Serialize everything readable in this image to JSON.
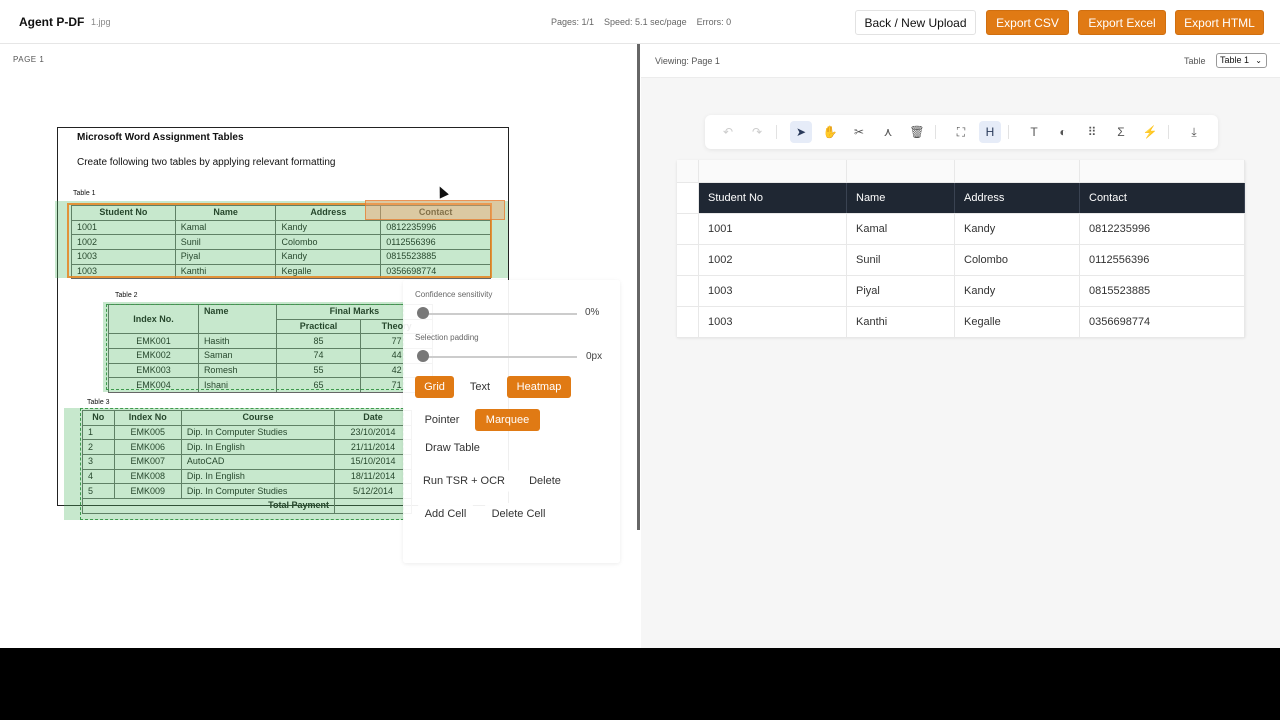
{
  "header": {
    "app_title": "Agent P-DF",
    "file_name": "1.jpg",
    "pages": "Pages: 1/1",
    "speed": "Speed: 5.1 sec/page",
    "errors": "Errors: 0",
    "back_label": "Back / New Upload",
    "export_csv": "Export CSV",
    "export_excel": "Export Excel",
    "export_html": "Export HTML"
  },
  "left": {
    "page_label": "PAGE 1",
    "doc_title": "Microsoft Word Assignment Tables",
    "doc_subtitle": "Create following two tables by applying relevant formatting",
    "table1": {
      "caption": "Table 1",
      "headers": [
        "Student No",
        "Name",
        "Address",
        "Contact"
      ],
      "rows": [
        [
          "1001",
          "Kamal",
          "Kandy",
          "0812235996"
        ],
        [
          "1002",
          "Sunil",
          "Colombo",
          "0112556396"
        ],
        [
          "1003",
          "Piyal",
          "Kandy",
          "0815523885"
        ],
        [
          "1003",
          "Kanthi",
          "Kegalle",
          "0356698774"
        ]
      ]
    },
    "table2": {
      "caption": "Table 2",
      "h_index": "Index No.",
      "h_name": "Name",
      "h_final": "Final Marks",
      "h_practical": "Practical",
      "h_theory": "Theory",
      "rows": [
        [
          "EMK001",
          "Hasith",
          "85",
          "77"
        ],
        [
          "EMK002",
          "Saman",
          "74",
          "44"
        ],
        [
          "EMK003",
          "Romesh",
          "55",
          "42"
        ],
        [
          "EMK004",
          "Ishani",
          "65",
          "71"
        ]
      ]
    },
    "table3": {
      "caption": "Table 3",
      "h_no": "No",
      "h_index": "Index No",
      "h_course": "Course",
      "h_date": "Date",
      "rows": [
        [
          "1",
          "EMK005",
          "Dip. In Computer Studies",
          "23/10/2014"
        ],
        [
          "2",
          "EMK006",
          "Dip. In English",
          "21/11/2014"
        ],
        [
          "3",
          "EMK007",
          "AutoCAD",
          "15/10/2014"
        ],
        [
          "4",
          "EMK008",
          "Dip. In English",
          "18/11/2014"
        ],
        [
          "5",
          "EMK009",
          "Dip. In Computer Studies",
          "5/12/2014"
        ]
      ],
      "total_label": "Total Payment"
    }
  },
  "panel": {
    "confidence_label": "Confidence sensitivity",
    "confidence_value": "0%",
    "confidence_level": 0,
    "padding_label": "Selection padding",
    "padding_value": "0px",
    "padding_level": 0,
    "grid": "Grid",
    "text": "Text",
    "heatmap": "Heatmap",
    "pointer": "Pointer",
    "marquee": "Marquee",
    "draw_table": "Draw Table",
    "run_tsr": "Run TSR + OCR",
    "delete": "Delete",
    "add_cell": "Add Cell",
    "delete_cell": "Delete Cell",
    "active_buttons": [
      "grid",
      "heatmap",
      "marquee"
    ]
  },
  "right": {
    "viewing": "Viewing: Page 1",
    "table_label": "Table",
    "table_select": "Table 1",
    "toolbar_icons": [
      "undo-icon",
      "redo-icon",
      "select-icon",
      "hand-icon",
      "scissors-icon",
      "merge-icon",
      "trash-icon",
      "fit-icon",
      "header-icon",
      "text-icon",
      "palette-icon",
      "grid-dots-icon",
      "sum-icon",
      "magic-icon",
      "download-icon"
    ],
    "grid": {
      "headers": [
        "Student No",
        "Name",
        "Address",
        "Contact"
      ],
      "rows": [
        [
          "1001",
          "Kamal",
          "Kandy",
          "0812235996"
        ],
        [
          "1002",
          "Sunil",
          "Colombo",
          "0112556396"
        ],
        [
          "1003",
          "Piyal",
          "Kandy",
          "0815523885"
        ],
        [
          "1003",
          "Kanthi",
          "Kegalle",
          "0356698774"
        ]
      ]
    }
  },
  "colors": {
    "accent": "#e07a14",
    "grid_header_bg": "#1f2733",
    "detection_overlay": "#50b964"
  }
}
